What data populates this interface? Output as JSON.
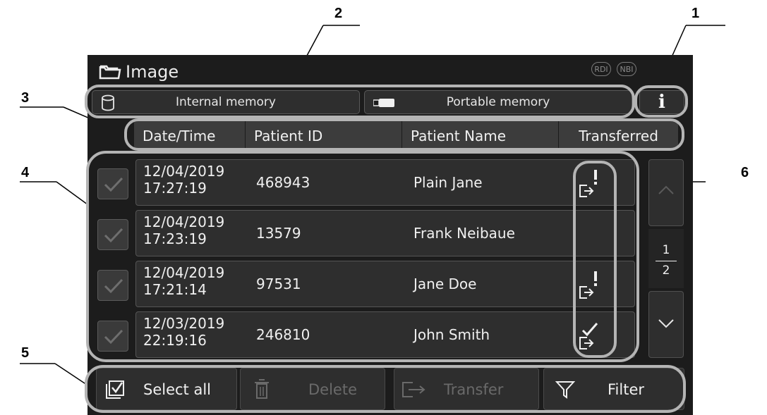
{
  "callouts": [
    "1",
    "2",
    "3",
    "4",
    "5",
    "6"
  ],
  "header": {
    "title": "Image",
    "mode_badges": [
      "RDI",
      "NBI"
    ]
  },
  "tabs": {
    "internal": "Internal memory",
    "portable": "Portable memory",
    "info": "i"
  },
  "columns": [
    "Date/Time",
    "Patient ID",
    "Patient Name",
    "Transferred"
  ],
  "rows": [
    {
      "date": "12/04/2019",
      "time": "17:27:19",
      "patient_id": "468943",
      "patient_name": "Plain Jane",
      "transferred": "error"
    },
    {
      "date": "12/04/2019",
      "time": "17:23:19",
      "patient_id": "13579",
      "patient_name": "Frank Neibaue",
      "transferred": "none"
    },
    {
      "date": "12/04/2019",
      "time": "17:21:14",
      "patient_id": "97531",
      "patient_name": "Jane Doe",
      "transferred": "error"
    },
    {
      "date": "12/03/2019",
      "time": "22:19:16",
      "patient_id": "246810",
      "patient_name": "John Smith",
      "transferred": "done"
    }
  ],
  "pagination": {
    "current": "1",
    "total": "2"
  },
  "actions": {
    "select_all": "Select all",
    "delete": "Delete",
    "transfer": "Transfer",
    "filter": "Filter"
  },
  "icons": [
    "folder-icon",
    "cylinder-storage-icon",
    "usb-drive-icon",
    "info-icon",
    "checkbox-icon",
    "transfer-error-icon",
    "transfer-done-icon",
    "chevron-up-icon",
    "chevron-down-icon",
    "select-all-icon",
    "trash-icon",
    "transfer-icon",
    "filter-icon"
  ],
  "colors": {
    "screen_bg": "#1c1c1c",
    "button_bg": "#2e2e2e",
    "callout_ring": "#b4b4b4",
    "disabled_text": "#6a6a6a"
  }
}
